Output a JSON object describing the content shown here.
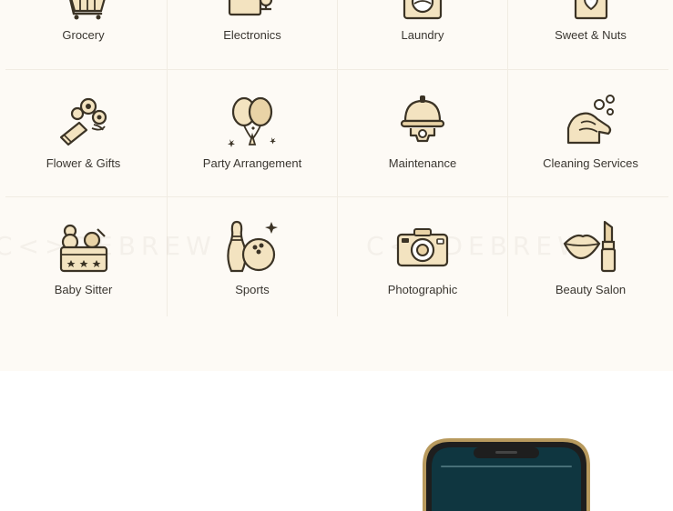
{
  "colors": {
    "section_bg": "#fdfaf5",
    "icon_stroke": "#3b3325",
    "icon_fill": "#f3e3c0",
    "label": "#3a3630"
  },
  "services": [
    {
      "label": "Grocery",
      "icon": "cart-icon"
    },
    {
      "label": "Electronics",
      "icon": "electronics-icon"
    },
    {
      "label": "Laundry",
      "icon": "laundry-icon"
    },
    {
      "label": "Sweet & Nuts",
      "icon": "sweet-box-icon"
    },
    {
      "label": "Flower & Gifts",
      "icon": "flower-bouquet-icon"
    },
    {
      "label": "Party Arrangement",
      "icon": "balloons-icon"
    },
    {
      "label": "Maintenance",
      "icon": "hard-hat-gear-icon"
    },
    {
      "label": "Cleaning Services",
      "icon": "cleaning-hands-icon"
    },
    {
      "label": "Baby Sitter",
      "icon": "toy-basket-icon"
    },
    {
      "label": "Sports",
      "icon": "bowling-icon"
    },
    {
      "label": "Photographic",
      "icon": "camera-icon"
    },
    {
      "label": "Beauty Salon",
      "icon": "lips-lipstick-icon"
    }
  ],
  "watermark": "C<>DEBREW"
}
